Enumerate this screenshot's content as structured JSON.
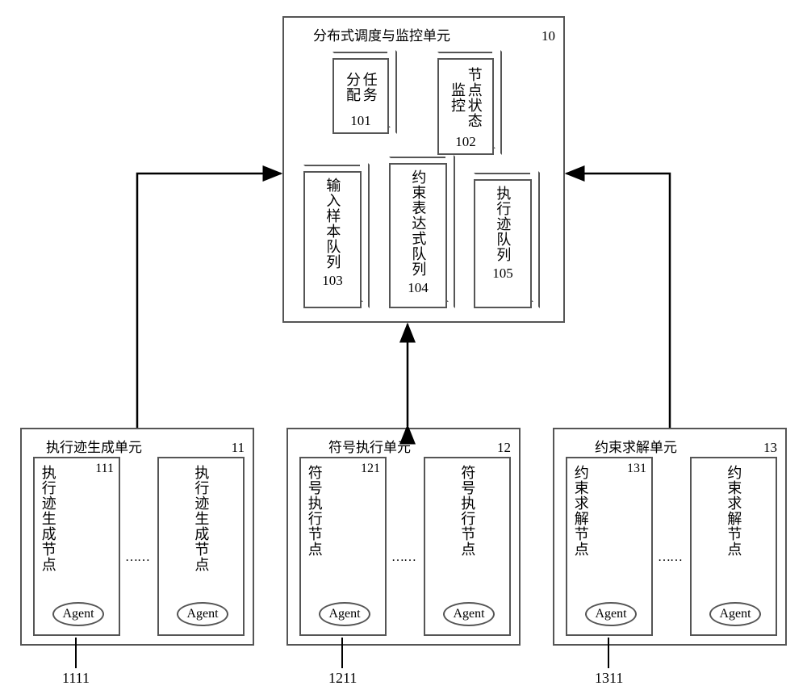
{
  "top_unit": {
    "title": "分布式调度与监控单元",
    "num": "10",
    "blocks": {
      "task_alloc": {
        "label": "任务分配",
        "num": "101"
      },
      "node_monitor": {
        "label": "节点状态监控",
        "num": "102"
      },
      "input_queue": {
        "label": "输入样本队列",
        "num": "103"
      },
      "constraint_queue": {
        "label": "约束表达式队列",
        "num": "104"
      },
      "trace_queue": {
        "label": "执行迹队列",
        "num": "105"
      }
    }
  },
  "bottom_units": {
    "trace_gen": {
      "title": "执行迹生成单元",
      "num": "11",
      "node_label": "执行迹生成节点",
      "node_num": "111",
      "agent": "Agent",
      "lead_num": "1111"
    },
    "symbolic": {
      "title": "符号执行单元",
      "num": "12",
      "node_label": "符号执行节点",
      "node_num": "121",
      "agent": "Agent",
      "lead_num": "1211"
    },
    "solver": {
      "title": "约束求解单元",
      "num": "13",
      "node_label": "约束求解节点",
      "node_num": "131",
      "agent": "Agent",
      "lead_num": "1311"
    }
  },
  "ellipsis": "……"
}
